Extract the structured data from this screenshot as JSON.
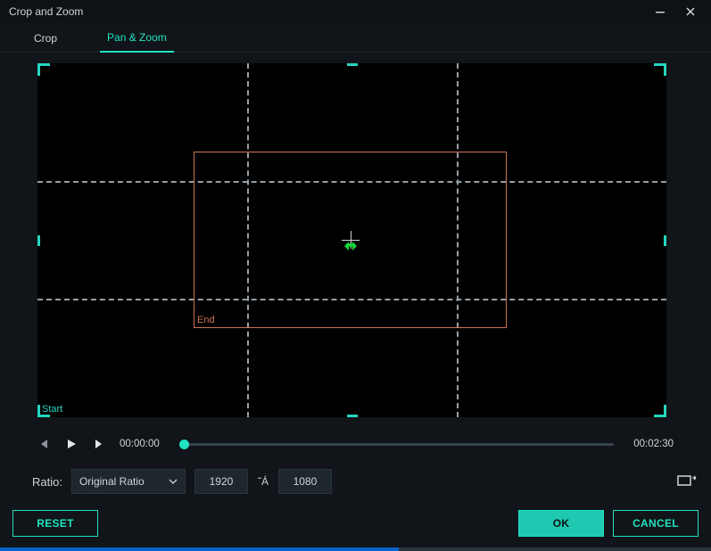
{
  "window": {
    "title": "Crop and Zoom"
  },
  "tabs": {
    "crop": "Crop",
    "pan_zoom": "Pan & Zoom"
  },
  "preview": {
    "start_label": "Start",
    "end_label": "End"
  },
  "playback": {
    "current_time": "00:00:00",
    "total_time": "00:02:30"
  },
  "ratio": {
    "label": "Ratio:",
    "selected": "Original Ratio",
    "width": "1920",
    "separator": "˜Á",
    "height": "1080"
  },
  "buttons": {
    "reset": "RESET",
    "ok": "OK",
    "cancel": "CANCEL"
  },
  "colors": {
    "accent": "#1fe3c1",
    "end_frame": "#c97455",
    "arrow": "#17d636"
  }
}
